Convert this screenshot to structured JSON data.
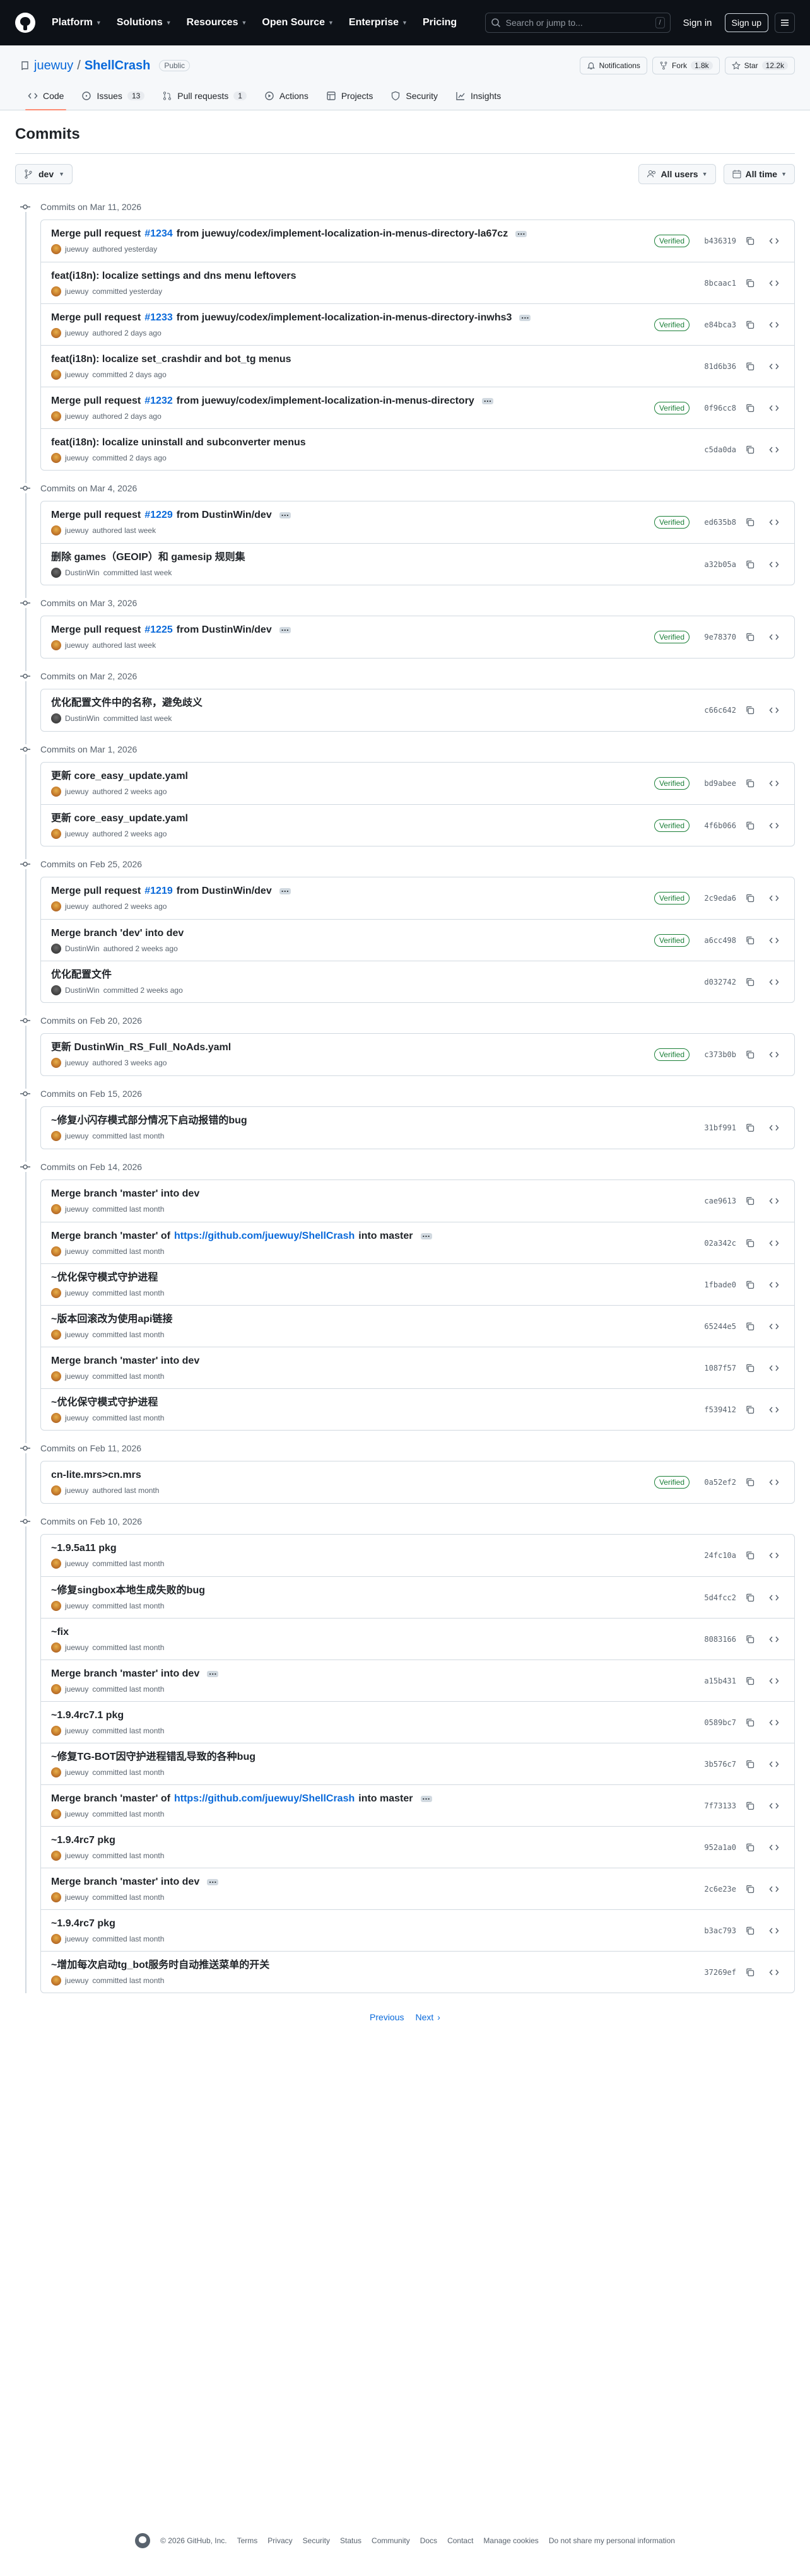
{
  "nav": {
    "items": [
      "Platform",
      "Solutions",
      "Resources",
      "Open Source",
      "Enterprise"
    ],
    "pricing": "Pricing",
    "search_placeholder": "Search or jump to...",
    "search_key": "/",
    "signin": "Sign in",
    "signup": "Sign up"
  },
  "repo": {
    "owner": "juewuy",
    "name": "ShellCrash",
    "visibility": "Public",
    "notifications": "Notifications",
    "fork_label": "Fork",
    "fork_count": "1.8k",
    "star_label": "Star",
    "star_count": "12.2k",
    "tabs": [
      {
        "label": "Code",
        "count": ""
      },
      {
        "label": "Issues",
        "count": "13"
      },
      {
        "label": "Pull requests",
        "count": "1"
      },
      {
        "label": "Actions",
        "count": ""
      },
      {
        "label": "Projects",
        "count": ""
      },
      {
        "label": "Security",
        "count": ""
      },
      {
        "label": "Insights",
        "count": ""
      }
    ]
  },
  "page": {
    "title": "Commits",
    "branch": "dev",
    "users_filter": "All users",
    "time_filter": "All time"
  },
  "groups": [
    {
      "date": "Commits on Mar 11, 2026",
      "commits": [
        {
          "msg": "Merge pull request ",
          "link": "#1234",
          "rest": " from juewuy/codex/implement-localization-in-menus-directory-la67cz",
          "dots": true,
          "author": "juewuy",
          "action": "authored yesterday",
          "avatar": "j",
          "verified": true,
          "sha": "b436319"
        },
        {
          "msg": "feat(i18n): localize settings and dns menu leftovers",
          "link": "",
          "rest": "",
          "dots": false,
          "author": "juewuy",
          "action": "committed yesterday",
          "avatar": "j",
          "verified": false,
          "sha": "8bcaac1"
        },
        {
          "msg": "Merge pull request ",
          "link": "#1233",
          "rest": " from juewuy/codex/implement-localization-in-menus-directory-inwhs3",
          "dots": true,
          "author": "juewuy",
          "action": "authored 2 days ago",
          "avatar": "j",
          "verified": true,
          "sha": "e84bca3"
        },
        {
          "msg": "feat(i18n): localize set_crashdir and bot_tg menus",
          "link": "",
          "rest": "",
          "dots": false,
          "author": "juewuy",
          "action": "committed 2 days ago",
          "avatar": "j",
          "verified": false,
          "sha": "81d6b36"
        },
        {
          "msg": "Merge pull request ",
          "link": "#1232",
          "rest": " from juewuy/codex/implement-localization-in-menus-directory",
          "dots": true,
          "author": "juewuy",
          "action": "authored 2 days ago",
          "avatar": "j",
          "verified": true,
          "sha": "0f96cc8"
        },
        {
          "msg": "feat(i18n): localize uninstall and subconverter menus",
          "link": "",
          "rest": "",
          "dots": false,
          "author": "juewuy",
          "action": "committed 2 days ago",
          "avatar": "j",
          "verified": false,
          "sha": "c5da0da"
        }
      ]
    },
    {
      "date": "Commits on Mar 4, 2026",
      "commits": [
        {
          "msg": "Merge pull request ",
          "link": "#1229",
          "rest": " from DustinWin/dev",
          "dots": true,
          "author": "juewuy",
          "action": "authored last week",
          "avatar": "j",
          "verified": true,
          "sha": "ed635b8"
        },
        {
          "msg": "删除 games（GEOIP）和 gamesip 规则集",
          "link": "",
          "rest": "",
          "dots": false,
          "author": "DustinWin",
          "action": "committed last week",
          "avatar": "d",
          "verified": false,
          "sha": "a32b05a"
        }
      ]
    },
    {
      "date": "Commits on Mar 3, 2026",
      "commits": [
        {
          "msg": "Merge pull request ",
          "link": "#1225",
          "rest": " from DustinWin/dev",
          "dots": true,
          "author": "juewuy",
          "action": "authored last week",
          "avatar": "j",
          "verified": true,
          "sha": "9e78370"
        }
      ]
    },
    {
      "date": "Commits on Mar 2, 2026",
      "commits": [
        {
          "msg": "优化配置文件中的名称，避免歧义",
          "link": "",
          "rest": "",
          "dots": false,
          "author": "DustinWin",
          "action": "committed last week",
          "avatar": "d",
          "verified": false,
          "sha": "c66c642"
        }
      ]
    },
    {
      "date": "Commits on Mar 1, 2026",
      "commits": [
        {
          "msg": "更新 core_easy_update.yaml",
          "link": "",
          "rest": "",
          "dots": false,
          "author": "juewuy",
          "action": "authored 2 weeks ago",
          "avatar": "j",
          "verified": true,
          "sha": "bd9abee"
        },
        {
          "msg": "更新 core_easy_update.yaml",
          "link": "",
          "rest": "",
          "dots": false,
          "author": "juewuy",
          "action": "authored 2 weeks ago",
          "avatar": "j",
          "verified": true,
          "sha": "4f6b066"
        }
      ]
    },
    {
      "date": "Commits on Feb 25, 2026",
      "commits": [
        {
          "msg": "Merge pull request ",
          "link": "#1219",
          "rest": " from DustinWin/dev",
          "dots": true,
          "author": "juewuy",
          "action": "authored 2 weeks ago",
          "avatar": "j",
          "verified": true,
          "sha": "2c9eda6"
        },
        {
          "msg": "Merge branch 'dev' into dev",
          "link": "",
          "rest": "",
          "dots": false,
          "author": "DustinWin",
          "action": "authored 2 weeks ago",
          "avatar": "d",
          "verified": true,
          "sha": "a6cc498"
        },
        {
          "msg": "优化配置文件",
          "link": "",
          "rest": "",
          "dots": false,
          "author": "DustinWin",
          "action": "committed 2 weeks ago",
          "avatar": "d",
          "verified": false,
          "sha": "d032742"
        }
      ]
    },
    {
      "date": "Commits on Feb 20, 2026",
      "commits": [
        {
          "msg": "更新 DustinWin_RS_Full_NoAds.yaml",
          "link": "",
          "rest": "",
          "dots": false,
          "author": "juewuy",
          "action": "authored 3 weeks ago",
          "avatar": "j",
          "verified": true,
          "sha": "c373b0b"
        }
      ]
    },
    {
      "date": "Commits on Feb 15, 2026",
      "commits": [
        {
          "msg": "~修复小闪存模式部分情况下启动报错的bug",
          "link": "",
          "rest": "",
          "dots": false,
          "author": "juewuy",
          "action": "committed last month",
          "avatar": "j",
          "verified": false,
          "sha": "31bf991"
        }
      ]
    },
    {
      "date": "Commits on Feb 14, 2026",
      "commits": [
        {
          "msg": "Merge branch 'master' into dev",
          "link": "",
          "rest": "",
          "dots": false,
          "author": "juewuy",
          "action": "committed last month",
          "avatar": "j",
          "verified": false,
          "sha": "cae9613"
        },
        {
          "msg": "Merge branch 'master' of ",
          "link": "https://github.com/juewuy/ShellCrash",
          "rest": " into master",
          "dots": true,
          "author": "juewuy",
          "action": "committed last month",
          "avatar": "j",
          "verified": false,
          "sha": "02a342c"
        },
        {
          "msg": "~优化保守模式守护进程",
          "link": "",
          "rest": "",
          "dots": false,
          "author": "juewuy",
          "action": "committed last month",
          "avatar": "j",
          "verified": false,
          "sha": "1fbade0"
        },
        {
          "msg": "~版本回滚改为使用api链接",
          "link": "",
          "rest": "",
          "dots": false,
          "author": "juewuy",
          "action": "committed last month",
          "avatar": "j",
          "verified": false,
          "sha": "65244e5"
        },
        {
          "msg": "Merge branch 'master' into dev",
          "link": "",
          "rest": "",
          "dots": false,
          "author": "juewuy",
          "action": "committed last month",
          "avatar": "j",
          "verified": false,
          "sha": "1087f57"
        },
        {
          "msg": "~优化保守模式守护进程",
          "link": "",
          "rest": "",
          "dots": false,
          "author": "juewuy",
          "action": "committed last month",
          "avatar": "j",
          "verified": false,
          "sha": "f539412"
        }
      ]
    },
    {
      "date": "Commits on Feb 11, 2026",
      "commits": [
        {
          "msg": "cn-lite.mrs>cn.mrs",
          "link": "",
          "rest": "",
          "dots": false,
          "author": "juewuy",
          "action": "authored last month",
          "avatar": "j",
          "verified": true,
          "sha": "0a52ef2"
        }
      ]
    },
    {
      "date": "Commits on Feb 10, 2026",
      "commits": [
        {
          "msg": "~1.9.5a11 pkg",
          "link": "",
          "rest": "",
          "dots": false,
          "author": "juewuy",
          "action": "committed last month",
          "avatar": "j",
          "verified": false,
          "sha": "24fc10a"
        },
        {
          "msg": "~修复singbox本地生成失败的bug",
          "link": "",
          "rest": "",
          "dots": false,
          "author": "juewuy",
          "action": "committed last month",
          "avatar": "j",
          "verified": false,
          "sha": "5d4fcc2"
        },
        {
          "msg": "~fix",
          "link": "",
          "rest": "",
          "dots": false,
          "author": "juewuy",
          "action": "committed last month",
          "avatar": "j",
          "verified": false,
          "sha": "8083166"
        },
        {
          "msg": "Merge branch 'master' into dev",
          "link": "",
          "rest": "",
          "dots": true,
          "author": "juewuy",
          "action": "committed last month",
          "avatar": "j",
          "verified": false,
          "sha": "a15b431"
        },
        {
          "msg": "~1.9.4rc7.1 pkg",
          "link": "",
          "rest": "",
          "dots": false,
          "author": "juewuy",
          "action": "committed last month",
          "avatar": "j",
          "verified": false,
          "sha": "0589bc7"
        },
        {
          "msg": "~修复TG-BOT因守护进程错乱导致的各种bug",
          "link": "",
          "rest": "",
          "dots": false,
          "author": "juewuy",
          "action": "committed last month",
          "avatar": "j",
          "verified": false,
          "sha": "3b576c7"
        },
        {
          "msg": "Merge branch 'master' of ",
          "link": "https://github.com/juewuy/ShellCrash",
          "rest": " into master",
          "dots": true,
          "author": "juewuy",
          "action": "committed last month",
          "avatar": "j",
          "verified": false,
          "sha": "7f73133"
        },
        {
          "msg": "~1.9.4rc7 pkg",
          "link": "",
          "rest": "",
          "dots": false,
          "author": "juewuy",
          "action": "committed last month",
          "avatar": "j",
          "verified": false,
          "sha": "952a1a0"
        },
        {
          "msg": "Merge branch 'master' into dev",
          "link": "",
          "rest": "",
          "dots": true,
          "author": "juewuy",
          "action": "committed last month",
          "avatar": "j",
          "verified": false,
          "sha": "2c6e23e"
        },
        {
          "msg": "~1.9.4rc7 pkg",
          "link": "",
          "rest": "",
          "dots": false,
          "author": "juewuy",
          "action": "committed last month",
          "avatar": "j",
          "verified": false,
          "sha": "b3ac793"
        },
        {
          "msg": "~增加每次启动tg_bot服务时自动推送菜单的开关",
          "link": "",
          "rest": "",
          "dots": false,
          "author": "juewuy",
          "action": "committed last month",
          "avatar": "j",
          "verified": false,
          "sha": "37269ef"
        }
      ]
    }
  ],
  "pager": {
    "prev": "Previous",
    "next": "Next"
  },
  "verified_label": "Verified",
  "footer": {
    "copyright": "© 2026 GitHub, Inc.",
    "links": [
      "Terms",
      "Privacy",
      "Security",
      "Status",
      "Community",
      "Docs",
      "Contact",
      "Manage cookies",
      "Do not share my personal information"
    ]
  },
  "icons": {
    "commit": "git-commit-icon",
    "copy": "copy-icon",
    "browse": "code-icon"
  }
}
